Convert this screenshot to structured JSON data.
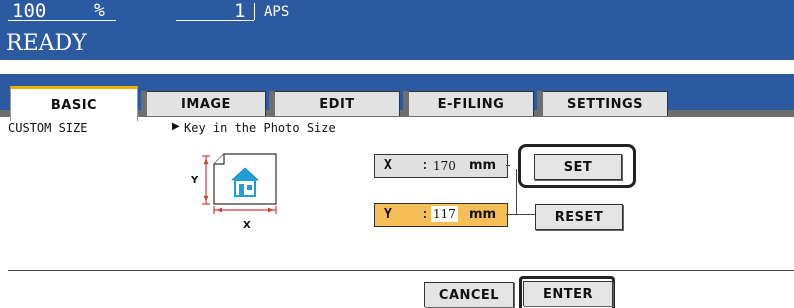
{
  "status": {
    "copies_percent": "100",
    "percent_symbol": "%",
    "count": "1",
    "paper_mode": "APS",
    "state": "READY"
  },
  "tabs": [
    {
      "label": "BASIC",
      "active": true
    },
    {
      "label": "IMAGE",
      "active": false
    },
    {
      "label": "EDIT",
      "active": false
    },
    {
      "label": "E-FILING",
      "active": false
    },
    {
      "label": "SETTINGS",
      "active": false
    }
  ],
  "page": {
    "title": "CUSTOM SIZE",
    "instruction": "Key in the Photo Size"
  },
  "diagram": {
    "y_label": "Y",
    "x_label": "X"
  },
  "fields": {
    "x": {
      "axis": "X",
      "separator": ":",
      "value": "170",
      "unit": "mm"
    },
    "y": {
      "axis": "Y",
      "separator": ":",
      "value": "117",
      "unit": "mm"
    }
  },
  "buttons": {
    "set": "SET",
    "reset": "RESET",
    "cancel": "CANCEL",
    "enter": "ENTER"
  },
  "colors": {
    "header_bg": "#2c5aa0",
    "active_field": "#f6be57",
    "active_tab_accent": "#f0b000",
    "button_bg": "#e4e4e4"
  }
}
